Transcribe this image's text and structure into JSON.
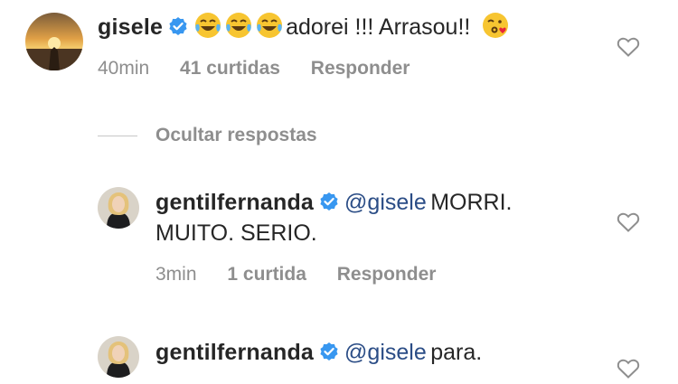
{
  "comments": [
    {
      "username": "gisele",
      "text": "adorei !!! Arrasou!!",
      "emojis": [
        "face-with-tears-of-joy",
        "face-with-tears-of-joy",
        "face-with-tears-of-joy",
        "face-blowing-a-kiss"
      ],
      "time": "40min",
      "likes": "41 curtidas",
      "reply": "Responder"
    }
  ],
  "toggle_replies": "Ocultar respostas",
  "replies": [
    {
      "username": "gentilfernanda",
      "mention": "@gisele",
      "text_line1": "MORRI.",
      "text_line2": "MUITO. SERIO.",
      "time": "3min",
      "likes": "1 curtida",
      "reply": "Responder"
    },
    {
      "username": "gentilfernanda",
      "mention": "@gisele",
      "text": "para."
    }
  ],
  "colors": {
    "verified": "#3897f0",
    "mention": "#2b4d86",
    "meta": "#8e8e8e",
    "text": "#262626"
  }
}
